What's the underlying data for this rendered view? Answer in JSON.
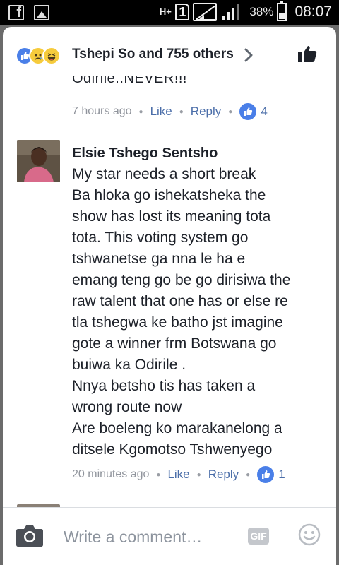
{
  "status_bar": {
    "network": "H+",
    "sim_slot": "1",
    "battery_percent": "38%",
    "time": "08:07"
  },
  "reactions": {
    "icons": [
      "like-icon",
      "sad-icon",
      "haha-icon"
    ],
    "summary": "Tshepi So and 755 others"
  },
  "previous_comment": {
    "tail_text": "Odirile..NEVER!!!",
    "timestamp": "7 hours ago",
    "like_label": "Like",
    "reply_label": "Reply",
    "like_count": "4"
  },
  "comment": {
    "author": "Elsie Tshego Sentsho",
    "lines": [
      "My star needs a short break",
      "Ba hloka go ishekatsheka the",
      "show has lost its meaning tota",
      "tota. This voting system go",
      "tshwanetse ga nna le ha e",
      "emang teng go be go dirisiwa the",
      "raw talent that one has or else re",
      "tla tshegwa ke batho jst imagine",
      "gote a winner frm Botswana go",
      "buiwa ka Odirile .",
      "Nnya betsho tis has taken a",
      "wrong route now",
      "Are boeleng ko marakanelong a",
      "ditsele Kgomotso Tshwenyego"
    ],
    "timestamp": "20 minutes ago",
    "like_label": "Like",
    "reply_label": "Reply",
    "like_count": "1"
  },
  "composer": {
    "placeholder": "Write a comment…",
    "gif_label": "GIF"
  },
  "colors": {
    "link": "#4b6ea9",
    "like_blue": "#4a7fe8",
    "meta_gray": "#90949c",
    "text": "#1d2129"
  }
}
